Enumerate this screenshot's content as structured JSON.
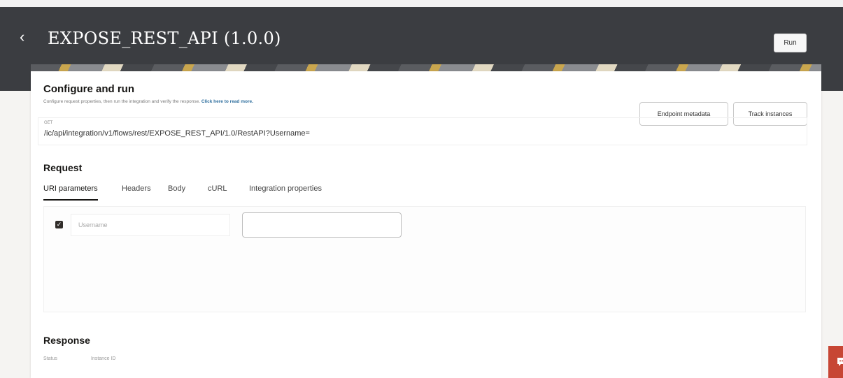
{
  "header": {
    "back_icon": "chevron-left-icon",
    "title": "EXPOSE_REST_API (1.0.0)",
    "run_label": "Run"
  },
  "configure": {
    "title": "Configure and run",
    "subtitle": "Configure request properties, then run the integration and verify the response.",
    "read_more": "Click here to read more.",
    "endpoint_metadata_label": "Endpoint metadata",
    "track_instances_label": "Track instances",
    "method": "GET",
    "url": "/ic/api/integration/v1/flows/rest/EXPOSE_REST_API/1.0/RestAPI?Username="
  },
  "request": {
    "title": "Request",
    "tabs": [
      {
        "label": "URI parameters"
      },
      {
        "label": "Headers"
      },
      {
        "label": "Body"
      },
      {
        "label": "cURL"
      },
      {
        "label": "Integration properties"
      }
    ],
    "param": {
      "checked": true,
      "name": "Username",
      "value": ""
    }
  },
  "response": {
    "title": "Response",
    "status_label": "Status",
    "instance_label": "Instance ID"
  },
  "colors": {
    "header_bg": "#3b3d41",
    "accent_red": "#c74634",
    "link": "#2f6f9e"
  }
}
